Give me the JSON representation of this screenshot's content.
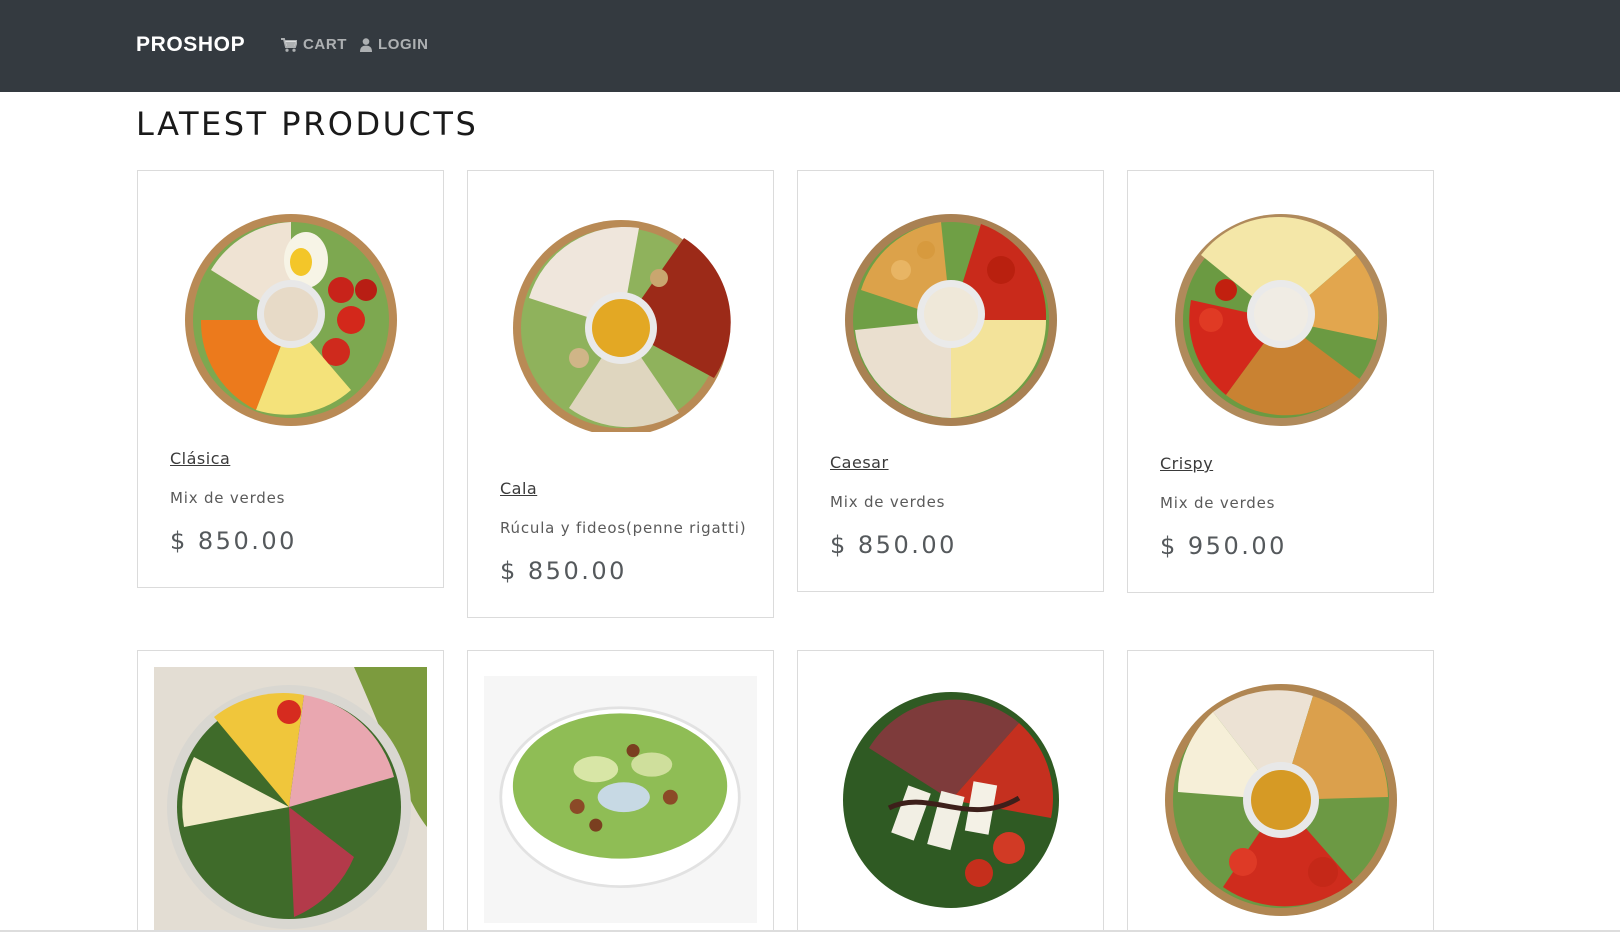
{
  "navbar": {
    "brand": "PROSHOP",
    "cart_label": "CART",
    "login_label": "LOGIN"
  },
  "main": {
    "title": "LATEST PRODUCTS",
    "products": [
      {
        "name": "Clásica",
        "description": "Mix de verdes",
        "price": "$ 850.00"
      },
      {
        "name": "Cala",
        "description": "Rúcula y fideos(penne rigatti)",
        "price": "$ 850.00"
      },
      {
        "name": "Caesar",
        "description": "Mix de verdes",
        "price": "$ 850.00"
      },
      {
        "name": "Crispy",
        "description": "Mix de verdes",
        "price": "$ 950.00"
      }
    ]
  },
  "icons": {
    "cart": "shopping-cart-icon",
    "login": "user-icon"
  },
  "colors": {
    "navbar_bg": "#343a40",
    "brand": "#ffffff",
    "nav_link": "rgba(255,255,255,0.6)",
    "bowl": "#b98a55"
  }
}
